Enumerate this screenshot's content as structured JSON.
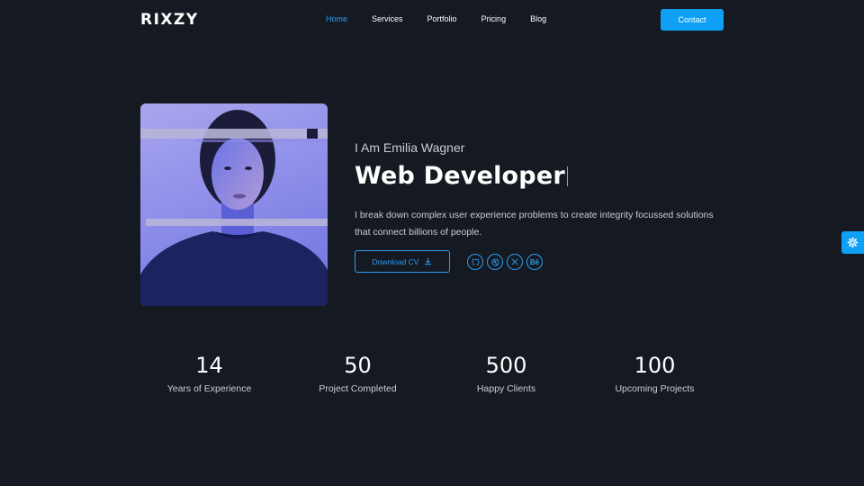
{
  "header": {
    "logo": "RIXZY",
    "nav": [
      {
        "label": "Home",
        "active": true
      },
      {
        "label": "Services",
        "active": false
      },
      {
        "label": "Portfolio",
        "active": false
      },
      {
        "label": "Pricing",
        "active": false
      },
      {
        "label": "Blog",
        "active": false
      }
    ],
    "contact_label": "Contact"
  },
  "hero": {
    "greeting": "I Am Emilia Wagner",
    "role": "Web Developer",
    "description": "I break down complex user experience problems to create integrity focussed solutions that connect billions of people.",
    "cv_label": "Download CV",
    "socials": [
      {
        "name": "github-icon",
        "glyph": "⚉"
      },
      {
        "name": "dribbble-icon",
        "glyph": "◎"
      },
      {
        "name": "x-icon",
        "glyph": "X"
      },
      {
        "name": "behance-icon",
        "glyph": "Bē"
      }
    ]
  },
  "stats": [
    {
      "value": "14",
      "label": "Years of Experience"
    },
    {
      "value": "50",
      "label": "Project Completed"
    },
    {
      "value": "500",
      "label": "Happy Clients"
    },
    {
      "value": "100",
      "label": "Upcoming Projects"
    }
  ],
  "colors": {
    "background": "#151a22",
    "accent": "#0ea0f5",
    "text_muted": "#c9ccd2"
  }
}
